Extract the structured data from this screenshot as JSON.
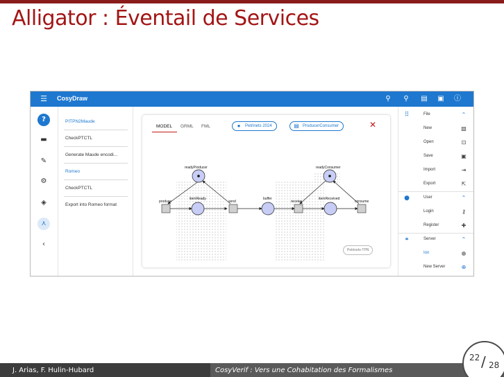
{
  "slide": {
    "title": "Alligator : Éventail de Services",
    "footer_authors": "J. Arias, F. Hulin-Hubard",
    "footer_title": "CosyVerif : Vers une Cohabitation des Formalismes",
    "page_current": "22",
    "page_total": "28",
    "accent_color": "#a31515"
  },
  "app": {
    "title": "CosyDraw",
    "menu_icon": "menu-icon",
    "toolbar_icons": [
      "search-icon",
      "zoom-icon",
      "print-icon",
      "save-icon",
      "info-icon"
    ],
    "brand_color": "#1e78cf"
  },
  "rail": {
    "help_label": "?",
    "items": [
      "help-icon",
      "folder-icon",
      "pencil-icon",
      "gear-icon",
      "paint-bucket-icon",
      "network-icon",
      "chevron-left-icon"
    ]
  },
  "tools": {
    "items": [
      {
        "label": "PITPN2Maude",
        "selected": true
      },
      {
        "label": "CheckPTCTL",
        "selected": false
      },
      {
        "label": "Generate Maude encodi...",
        "selected": false
      },
      {
        "label": "Romeo",
        "selected": true
      },
      {
        "label": "CheckPTCTL",
        "selected": false
      },
      {
        "label": "Export into Romeo format",
        "selected": false
      }
    ]
  },
  "editor": {
    "tabs": [
      "MODEL",
      "GRML",
      "FML"
    ],
    "active_tab": "MODEL",
    "chips": [
      "Petrinets 2024",
      "ProducerConsumer"
    ],
    "badge": "Petrinets-TPN",
    "net": {
      "places": [
        "readyProducer",
        "itemReady",
        "buffer",
        "readyConsumer",
        "itemReceived"
      ],
      "transitions": [
        "produce",
        "send",
        "receive",
        "consume"
      ]
    }
  },
  "right_panel": {
    "sections": [
      {
        "label": "File",
        "lead": "grid-icon",
        "trail": "chevron-up-icon"
      },
      {
        "label": "New",
        "trail": "new-file-icon"
      },
      {
        "label": "Open",
        "trail": "open-icon"
      },
      {
        "label": "Save",
        "trail": "save-icon"
      },
      {
        "label": "Import",
        "trail": "import-icon"
      },
      {
        "label": "Export",
        "trail": "export-icon"
      },
      {
        "label": "User",
        "lead": "account-icon",
        "trail": "chevron-up-icon"
      },
      {
        "label": "Login",
        "trail": "login-icon"
      },
      {
        "label": "Register",
        "trail": "register-icon"
      },
      {
        "label": "Server",
        "lead": "server-icon",
        "trail": "chevron-up-icon"
      },
      {
        "label": "Ion",
        "trail": "info-circle-icon"
      },
      {
        "label": "New Server",
        "trail": "add-circle-icon"
      }
    ]
  }
}
